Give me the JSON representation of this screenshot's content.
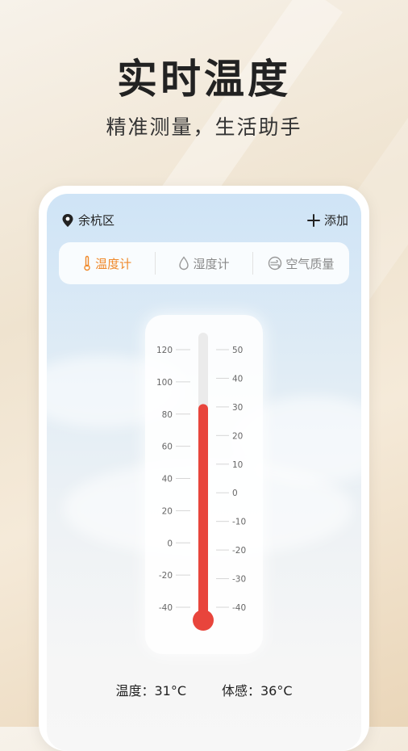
{
  "hero": {
    "title": "实时温度",
    "subtitle": "精准测量，生活助手"
  },
  "header": {
    "location": "余杭区",
    "add_label": "添加"
  },
  "tabs": [
    {
      "label": "温度计",
      "icon": "thermometer-icon",
      "active": true
    },
    {
      "label": "湿度计",
      "icon": "droplet-icon",
      "active": false
    },
    {
      "label": "空气质量",
      "icon": "air-quality-icon",
      "active": false
    }
  ],
  "thermometer": {
    "fahrenheit_ticks": [
      "120",
      "100",
      "80",
      "60",
      "40",
      "20",
      "0",
      "-20",
      "-40"
    ],
    "celsius_ticks": [
      "50",
      "40",
      "30",
      "20",
      "10",
      "0",
      "-10",
      "-20",
      "-30",
      "-40"
    ],
    "scale_min_c": -40,
    "scale_max_c": 50,
    "mercury_c": 31,
    "mercury_color": "#e8453c"
  },
  "readouts": {
    "temperature": "温度：31°C",
    "feels_like": "体感：36°C"
  },
  "colors": {
    "accent": "#f0892a",
    "mercury": "#e8453c"
  }
}
